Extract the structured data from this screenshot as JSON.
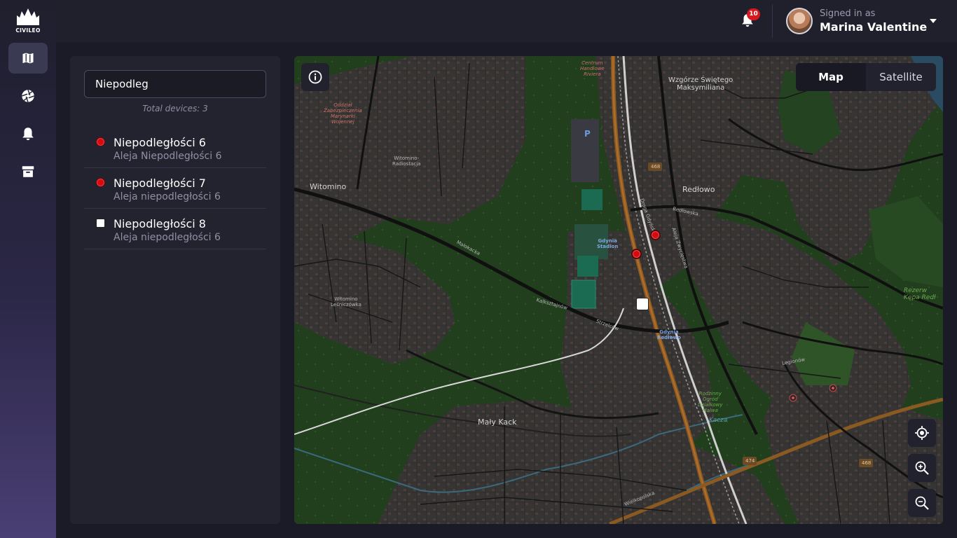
{
  "app": {
    "logo_text": "CIVILEO"
  },
  "sidebar": {
    "items": [
      {
        "name": "map",
        "icon": "map-icon",
        "active": true
      },
      {
        "name": "camera",
        "icon": "aperture-icon",
        "active": false
      },
      {
        "name": "notifications",
        "icon": "bell-icon",
        "active": false
      },
      {
        "name": "archive",
        "icon": "archive-icon",
        "active": false
      }
    ]
  },
  "header": {
    "notifications_count": "10",
    "signed_in_label": "Signed in as",
    "user_name": "Marina Valentine"
  },
  "panel": {
    "search_value": "Niepodleg",
    "total_devices": "Total devices: 3",
    "devices": [
      {
        "name": "Niepodległości 6",
        "address": "Aleja Niepodległości 6",
        "status_color": "#d50b12",
        "marker": "red-dot"
      },
      {
        "name": "Niepodległości 7",
        "address": "Aleja niepodległości 6",
        "status_color": "#d50b12",
        "marker": "red-dot"
      },
      {
        "name": "Niepodległości 8",
        "address": "Aleja niepodległości 6",
        "status_color": "#ffffff",
        "marker": "white-square"
      }
    ]
  },
  "map": {
    "type_options": [
      "Map",
      "Satellite"
    ],
    "selected_type": "Map",
    "labels": {
      "witomino": "Witomino",
      "witomino_radiostacja": "Witomino-\nRadiostacja",
      "witomino_lesniczowka": "Witomino\nLeśniczówka",
      "redlowo": "Redłowo",
      "maly_kack": "Mały Kack",
      "wzgorze": "Wzgórze Świętego\nMaksymiliana",
      "gdynia_stadion": "Gdynia\nStadion",
      "gdynia_redlowo": "Gdynia\nRedłowo",
      "oddzial": "Oddział\nZabezpieczenia\nMarynarki\nWojennej",
      "centrum": "Centrum\nHandlowe\nRiviera",
      "rezerwat": "Rezerw\nKępa Redł",
      "rodzinny": "Rodzinny\nOgród\nDziałkowy\nMalwa",
      "kaczy": "Kacza",
      "road_468": "468",
      "road_474": "474",
      "road_468b": "468",
      "parking": "P",
      "street_malokacka": "Małokacka",
      "street_wielkopolska": "Wielkopolska",
      "street_legionow": "Legionów",
      "street_redlowska": "Redłowska",
      "street_droga_gdynska": "Droga Gdyńska",
      "street_aleja_zwyciestwa": "Aleja Zwycięstwa",
      "street_strzelcow": "Strzelców",
      "street_kalksztajnow": "Kalksztajnów"
    },
    "markers": [
      {
        "device": "Niepodległości 6",
        "color": "red"
      },
      {
        "device": "Niepodległości 7",
        "color": "red"
      },
      {
        "device": "Niepodległości 8",
        "color": "white"
      }
    ]
  },
  "colors": {
    "accent_red": "#d7191f",
    "panel_bg": "#232330",
    "app_bg": "#1b1b27",
    "map_forest": "#1f3c1c"
  }
}
